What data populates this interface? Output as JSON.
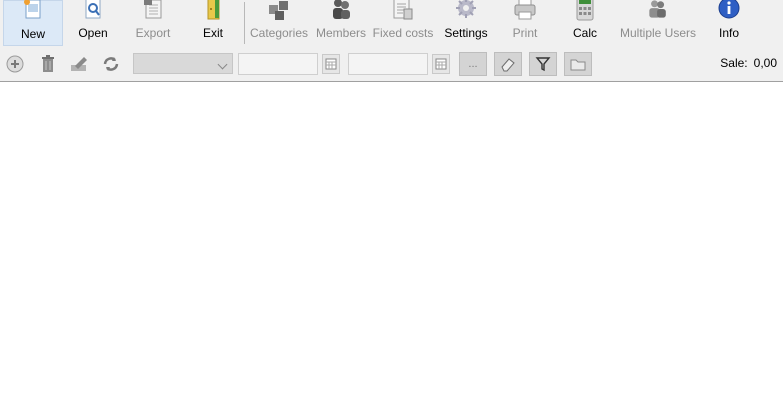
{
  "toolbar": {
    "new_label": "New",
    "open_label": "Open",
    "export_label": "Export",
    "exit_label": "Exit",
    "categories_label": "Categories",
    "members_label": "Members",
    "fixed_costs_label": "Fixed costs",
    "settings_label": "Settings",
    "print_label": "Print",
    "calc_label": "Calc",
    "multiple_users_label": "Multiple Users",
    "info_label": "Info"
  },
  "filterbar": {
    "combo_value": "",
    "date_from": "",
    "date_to": "",
    "more_label": "...",
    "sale_label": "Sale:",
    "sale_value": "0,00"
  },
  "colors": {
    "toolbar_bg": "#f0f0f0",
    "disabled_text": "#8d8d8d",
    "selected_bg": "#dce9f7",
    "info_blue": "#2f5fc4"
  }
}
